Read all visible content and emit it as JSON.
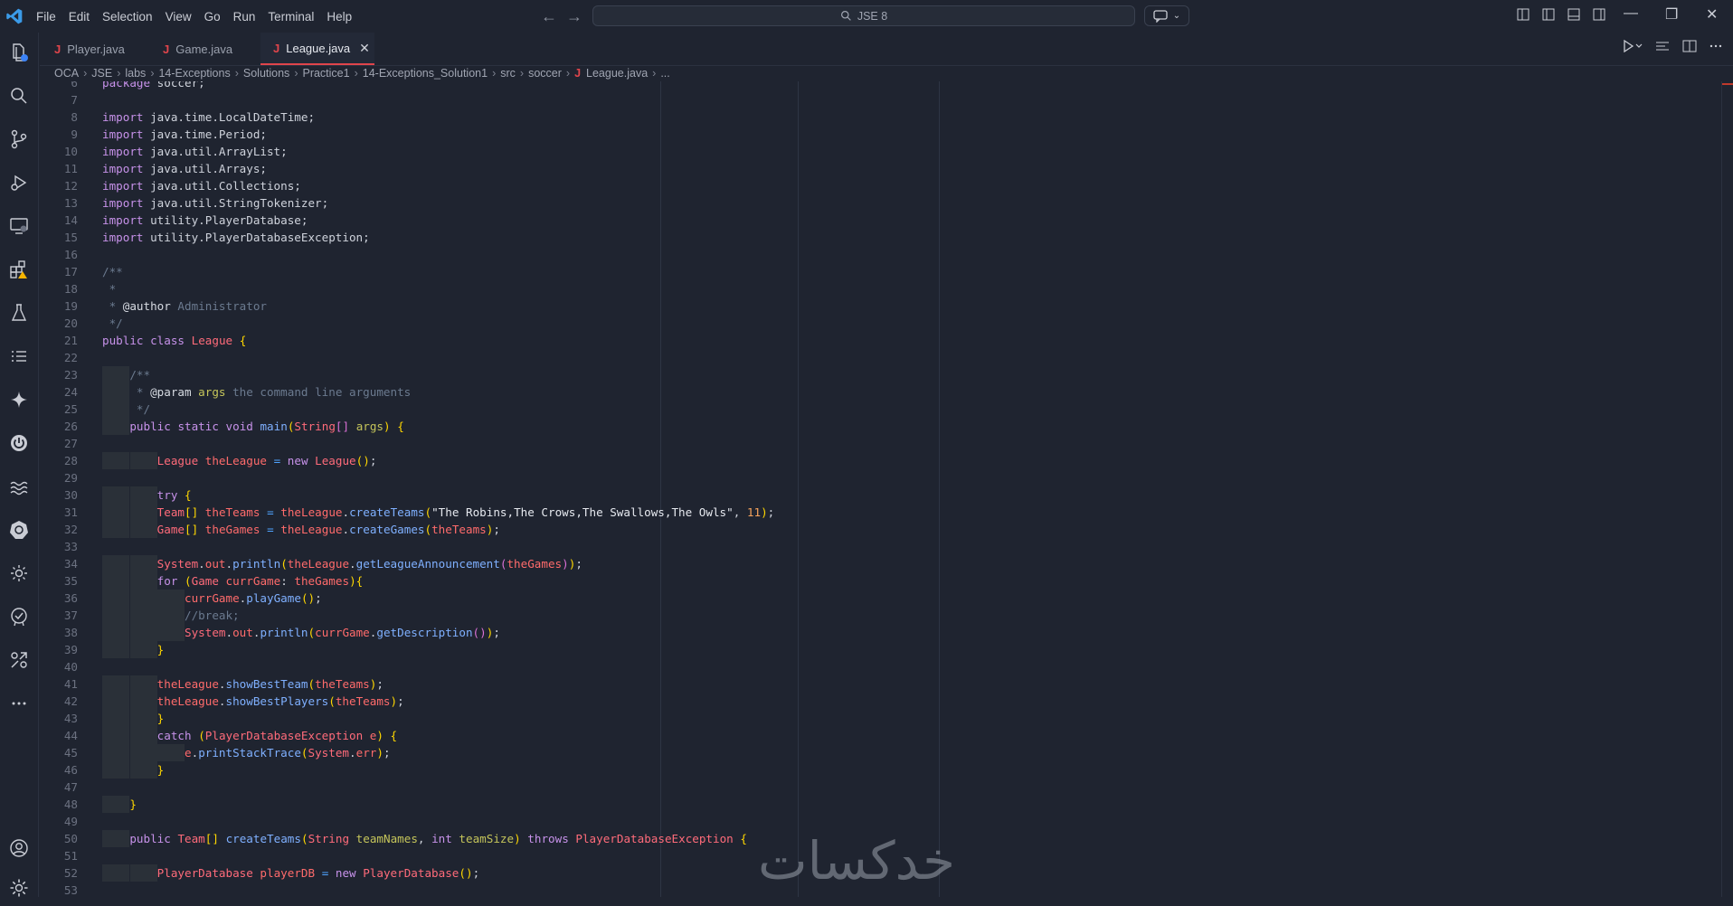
{
  "titlebar": {
    "menus": [
      "File",
      "Edit",
      "Selection",
      "View",
      "Go",
      "Run",
      "Terminal",
      "Help"
    ],
    "search_text": "JSE 8"
  },
  "tabs": [
    {
      "label": "Player.java",
      "active": false
    },
    {
      "label": "Game.java",
      "active": false
    },
    {
      "label": "League.java",
      "active": true
    }
  ],
  "breadcrumb": [
    "OCA",
    "JSE",
    "labs",
    "14-Exceptions",
    "Solutions",
    "Practice1",
    "14-Exceptions_Solution1",
    "src",
    "soccer",
    "League.java",
    "..."
  ],
  "editor": {
    "lines": [
      {
        "n": "6",
        "text": "package soccer;"
      },
      {
        "n": "7",
        "text": ""
      },
      {
        "n": "8",
        "text": "import java.time.LocalDateTime;"
      },
      {
        "n": "9",
        "text": "import java.time.Period;"
      },
      {
        "n": "10",
        "text": "import java.util.ArrayList;"
      },
      {
        "n": "11",
        "text": "import java.util.Arrays;"
      },
      {
        "n": "12",
        "text": "import java.util.Collections;"
      },
      {
        "n": "13",
        "text": "import java.util.StringTokenizer;"
      },
      {
        "n": "14",
        "text": "import utility.PlayerDatabase;"
      },
      {
        "n": "15",
        "text": "import utility.PlayerDatabaseException;"
      },
      {
        "n": "16",
        "text": ""
      },
      {
        "n": "17",
        "text": "/**"
      },
      {
        "n": "18",
        "text": " *"
      },
      {
        "n": "19",
        "text": " * @author Administrator"
      },
      {
        "n": "20",
        "text": " */"
      },
      {
        "n": "21",
        "text": "public class League {"
      },
      {
        "n": "22",
        "text": ""
      },
      {
        "n": "23",
        "text": "    /**"
      },
      {
        "n": "24",
        "text": "     * @param args the command line arguments"
      },
      {
        "n": "25",
        "text": "     */"
      },
      {
        "n": "26",
        "text": "    public static void main(String[] args) {"
      },
      {
        "n": "27",
        "text": ""
      },
      {
        "n": "28",
        "text": "        League theLeague = new League();"
      },
      {
        "n": "29",
        "text": ""
      },
      {
        "n": "30",
        "text": "        try {"
      },
      {
        "n": "31",
        "text": "        Team[] theTeams = theLeague.createTeams(\"The Robins,The Crows,The Swallows,The Owls\", 11);"
      },
      {
        "n": "32",
        "text": "        Game[] theGames = theLeague.createGames(theTeams);"
      },
      {
        "n": "33",
        "text": ""
      },
      {
        "n": "34",
        "text": "        System.out.println(theLeague.getLeagueAnnouncement(theGames));"
      },
      {
        "n": "35",
        "text": "        for (Game currGame: theGames){"
      },
      {
        "n": "36",
        "text": "            currGame.playGame();"
      },
      {
        "n": "37",
        "text": "            //break;"
      },
      {
        "n": "38",
        "text": "            System.out.println(currGame.getDescription());"
      },
      {
        "n": "39",
        "text": "        }"
      },
      {
        "n": "40",
        "text": ""
      },
      {
        "n": "41",
        "text": "        theLeague.showBestTeam(theTeams);"
      },
      {
        "n": "42",
        "text": "        theLeague.showBestPlayers(theTeams);"
      },
      {
        "n": "43",
        "text": "        }"
      },
      {
        "n": "44",
        "text": "        catch (PlayerDatabaseException e) {"
      },
      {
        "n": "45",
        "text": "            e.printStackTrace(System.err);"
      },
      {
        "n": "46",
        "text": "        }"
      },
      {
        "n": "47",
        "text": ""
      },
      {
        "n": "48",
        "text": "    }"
      },
      {
        "n": "49",
        "text": ""
      },
      {
        "n": "50",
        "text": "    public Team[] createTeams(String teamNames, int teamSize) throws PlayerDatabaseException {"
      },
      {
        "n": "51",
        "text": ""
      },
      {
        "n": "52",
        "text": "        PlayerDatabase playerDB = new PlayerDatabase();"
      },
      {
        "n": "53",
        "text": ""
      }
    ]
  },
  "watermark": "خدکسات",
  "colors": {
    "accent": "#e0454b",
    "background": "#1f2430"
  }
}
